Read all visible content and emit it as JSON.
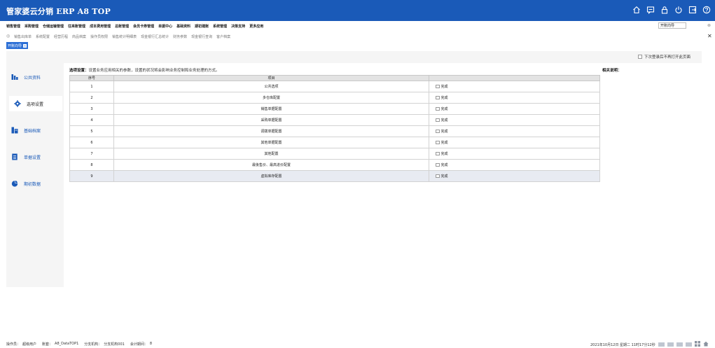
{
  "app": {
    "title": "管家婆云分销 ERP A8 TOP"
  },
  "title_icons": [
    "home-icon",
    "message-icon",
    "lock-icon",
    "power-icon",
    "logout-icon",
    "help-icon"
  ],
  "menu": [
    "销售管理",
    "采购管理",
    "仓储运输管理",
    "往来账管理",
    "成本费用管理",
    "总账管理",
    "会员卡券管理",
    "单据中心",
    "基础资料",
    "期初建账",
    "系统管理",
    "决策支持",
    "更多应用"
  ],
  "quick": {
    "value": "开账向导"
  },
  "tabs": [
    "销售出库单",
    "系统配置",
    "经营历程",
    "商品档案",
    "操作员权限",
    "销售统计明细表",
    "现金银行汇总统计",
    "财务参数",
    "现金银行查询",
    "客户档案"
  ],
  "active_tab": "开账向导",
  "no_open_label": "下次登录后不再打开此页面",
  "sidebar": [
    {
      "label": "公共资料",
      "icon": "bars-icon"
    },
    {
      "label": "选项设置",
      "icon": "gear-icon"
    },
    {
      "label": "基础档案",
      "icon": "archive-icon"
    },
    {
      "label": "单据设置",
      "icon": "document-icon"
    },
    {
      "label": "期初数据",
      "icon": "pie-chart-icon"
    }
  ],
  "option_desc": {
    "label": "选项设置：",
    "text": "设置业务应用相关的参数，设置的状况将会影响业务控制和业务处理的方式。"
  },
  "related_label": "相关说明：",
  "table": {
    "headers": [
      "序号",
      "项目",
      ""
    ],
    "rows": [
      {
        "no": "1",
        "item": "公共选项",
        "done": "完成"
      },
      {
        "no": "2",
        "item": "多仓库配置",
        "done": "完成"
      },
      {
        "no": "3",
        "item": "销售单据配置",
        "done": "完成"
      },
      {
        "no": "4",
        "item": "采购单据配置",
        "done": "完成"
      },
      {
        "no": "5",
        "item": "调拨单据配置",
        "done": "完成"
      },
      {
        "no": "6",
        "item": "其他单据配置",
        "done": "完成"
      },
      {
        "no": "7",
        "item": "其他配置",
        "done": "完成"
      },
      {
        "no": "8",
        "item": "最後售价、最高进价配置",
        "done": "完成"
      },
      {
        "no": "9",
        "item": "虚拟库存配置",
        "done": "完成"
      }
    ]
  },
  "status": {
    "operator_label": "操作员：",
    "operator": "超级用户",
    "account_label": "账套：",
    "account": "A8_DataTOP1",
    "branch_label": "分支机构：",
    "branch": "分支机构001",
    "period_label": "会计期间：",
    "period": "8",
    "datetime": "2021年10月12日 星期二 11时17分12秒"
  }
}
